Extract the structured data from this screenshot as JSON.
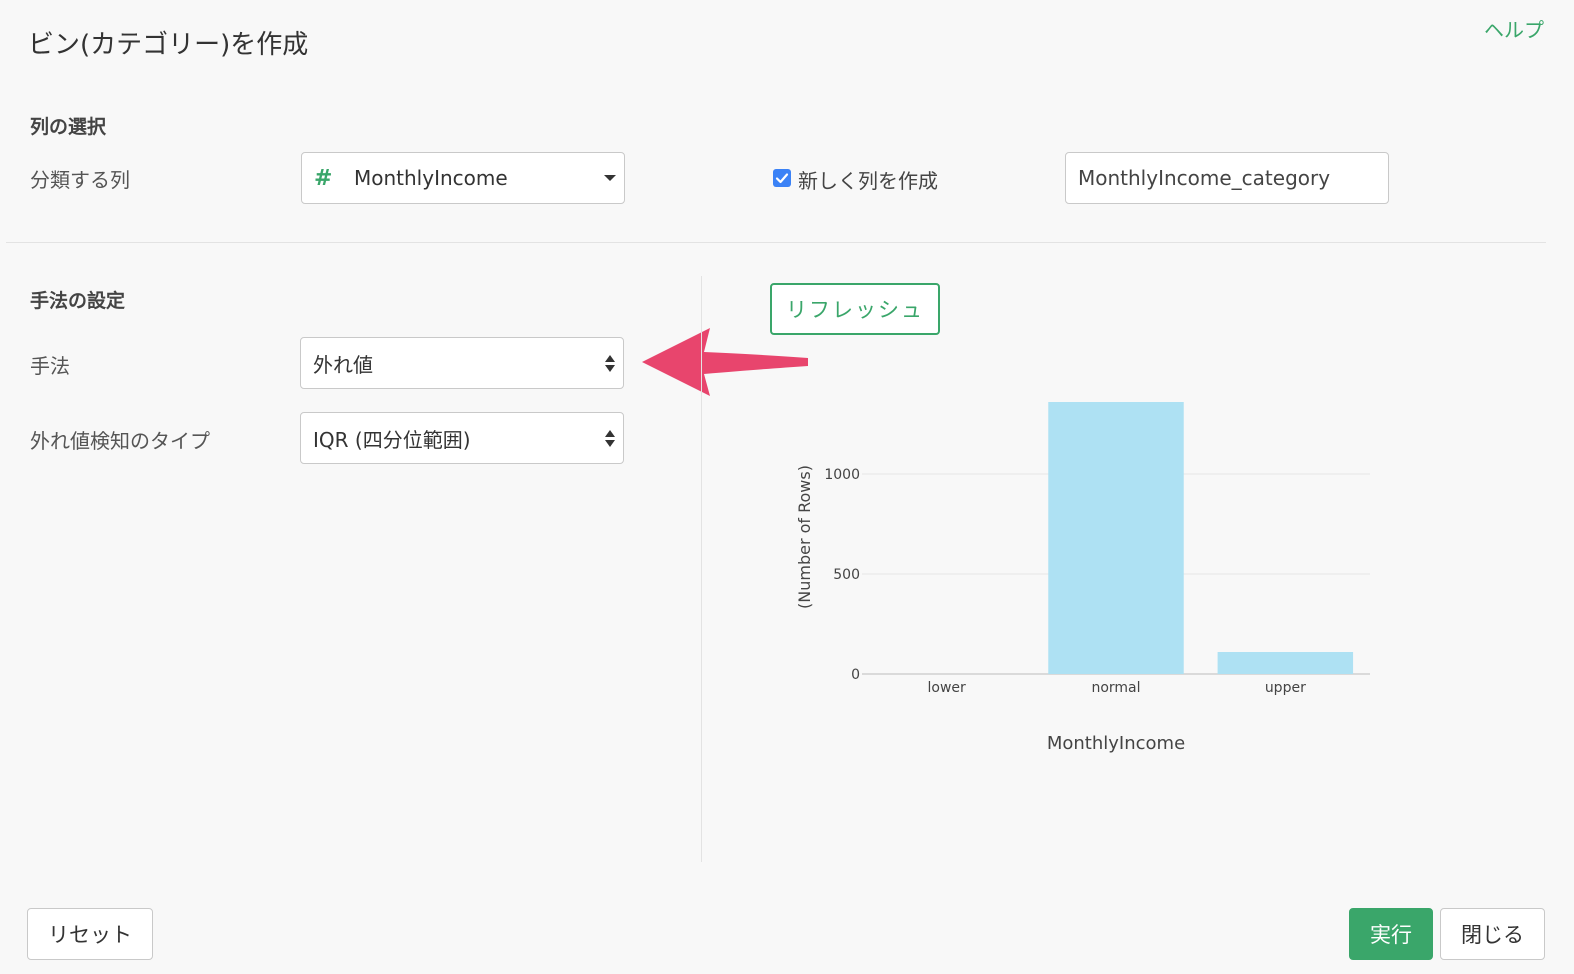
{
  "dialog": {
    "title": "ビン(カテゴリー)を作成",
    "help_label": "ヘルプ"
  },
  "column_section": {
    "heading": "列の選択",
    "classify_label": "分類する列",
    "column_type_icon": "#",
    "column_value": "MonthlyIncome",
    "new_column_checked": true,
    "new_column_label": "新しく列を作成",
    "new_column_name": "MonthlyIncome_category"
  },
  "method_section": {
    "heading": "手法の設定",
    "method_label": "手法",
    "method_value": "外れ値",
    "outlier_type_label": "外れ値検知のタイプ",
    "outlier_type_value": "IQR (四分位範囲)"
  },
  "refresh_label": "リフレッシュ",
  "annotation": {
    "arrow_color": "#e8456d"
  },
  "chart_data": {
    "type": "bar",
    "categories": [
      "lower",
      "normal",
      "upper"
    ],
    "values": [
      0,
      1360,
      110
    ],
    "xlabel": "MonthlyIncome",
    "ylabel": "(Number of Rows)",
    "yticks": [
      0,
      500,
      1000
    ],
    "ylim": [
      0,
      1420
    ],
    "bar_color": "#aee1f3",
    "grid": true
  },
  "footer": {
    "reset_label": "リセット",
    "run_label": "実行",
    "close_label": "閉じる"
  }
}
